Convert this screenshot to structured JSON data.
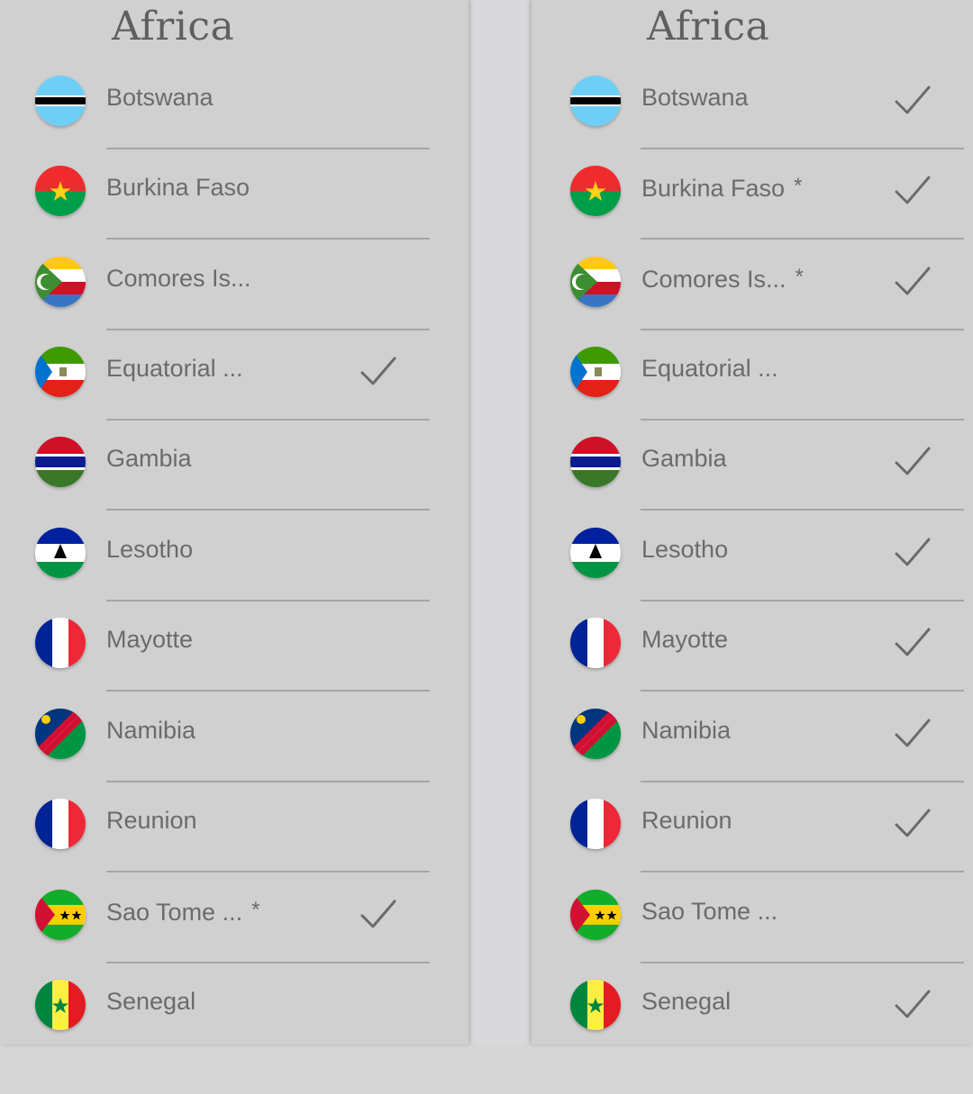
{
  "left": {
    "title": "Africa",
    "items": [
      {
        "name": "Botswana",
        "star": "",
        "checked": false
      },
      {
        "name": "Burkina Faso",
        "star": "",
        "checked": false
      },
      {
        "name": "Comores Is...",
        "star": "",
        "checked": false
      },
      {
        "name": "Equatorial ...",
        "star": "",
        "checked": true
      },
      {
        "name": "Gambia",
        "star": "",
        "checked": false
      },
      {
        "name": "Lesotho",
        "star": "",
        "checked": false
      },
      {
        "name": "Mayotte",
        "star": "",
        "checked": false
      },
      {
        "name": "Namibia",
        "star": "",
        "checked": false
      },
      {
        "name": "Reunion",
        "star": "",
        "checked": false
      },
      {
        "name": "Sao Tome ...",
        "star": "*",
        "checked": true
      },
      {
        "name": "Senegal",
        "star": "",
        "checked": false
      }
    ]
  },
  "right": {
    "title": "Africa",
    "items": [
      {
        "name": "Botswana",
        "star": "",
        "checked": true
      },
      {
        "name": "Burkina Faso",
        "star": "*",
        "checked": true
      },
      {
        "name": "Comores Is...",
        "star": "*",
        "checked": true
      },
      {
        "name": "Equatorial ...",
        "star": "",
        "checked": false
      },
      {
        "name": "Gambia",
        "star": "",
        "checked": true
      },
      {
        "name": "Lesotho",
        "star": "",
        "checked": true
      },
      {
        "name": "Mayotte",
        "star": "",
        "checked": true
      },
      {
        "name": "Namibia",
        "star": "",
        "checked": true
      },
      {
        "name": "Reunion",
        "star": "",
        "checked": true
      },
      {
        "name": "Sao Tome ...",
        "star": "",
        "checked": false
      },
      {
        "name": "Senegal",
        "star": "",
        "checked": true
      }
    ]
  },
  "colors": {
    "text": "#6b6b6b",
    "title": "#5f5f5f",
    "divider": "#a5a5a5",
    "check": "#6a6a6a",
    "panel_bg": "#d0d0d0"
  },
  "icons": {
    "check": "check-icon",
    "flags": [
      "botswana-flag-icon",
      "burkina-faso-flag-icon",
      "comores-flag-icon",
      "equatorial-guinea-flag-icon",
      "gambia-flag-icon",
      "lesotho-flag-icon",
      "mayotte-flag-icon",
      "namibia-flag-icon",
      "reunion-flag-icon",
      "sao-tome-flag-icon",
      "senegal-flag-icon"
    ]
  }
}
